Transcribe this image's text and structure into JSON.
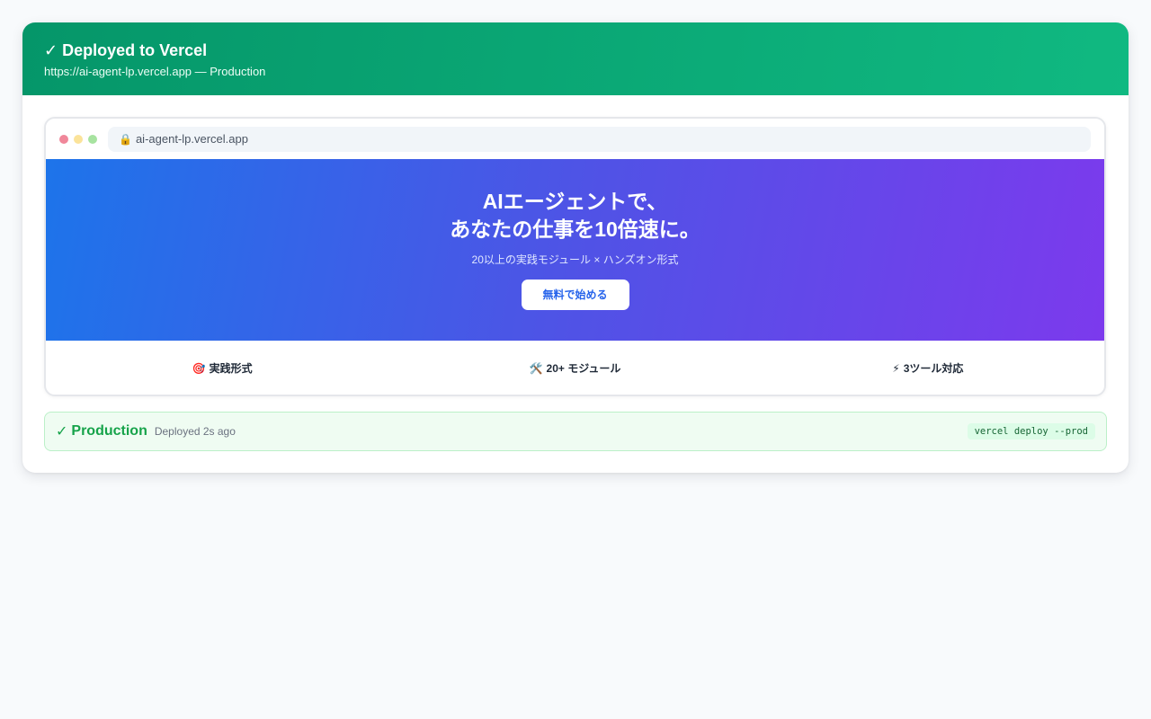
{
  "header": {
    "check_icon": "✓",
    "title": "Deployed to Vercel",
    "subtitle": "https://ai-agent-lp.vercel.app — Production"
  },
  "browser": {
    "url": "ai-agent-lp.vercel.app",
    "lock_icon": "🔒"
  },
  "hero": {
    "title_line1": "AIエージェントで、",
    "title_line2": "あなたの仕事を10倍速に。",
    "subtitle": "20以上の実践モジュール × ハンズオン形式",
    "cta_label": "無料で始める"
  },
  "features": [
    {
      "icon": "🎯",
      "label": "実践形式"
    },
    {
      "icon": "🛠️",
      "label": "20+ モジュール"
    },
    {
      "icon": "⚡",
      "label": "3ツール対応"
    }
  ],
  "status": {
    "check_icon": "✓",
    "label": "Production",
    "time": "Deployed 2s ago",
    "command": "vercel deploy --prod"
  },
  "colors": {
    "header_start": "#059669",
    "header_end": "#10b981",
    "hero_start": "#1d74ea",
    "hero_end": "#7c3aed",
    "success": "#16a34a"
  }
}
